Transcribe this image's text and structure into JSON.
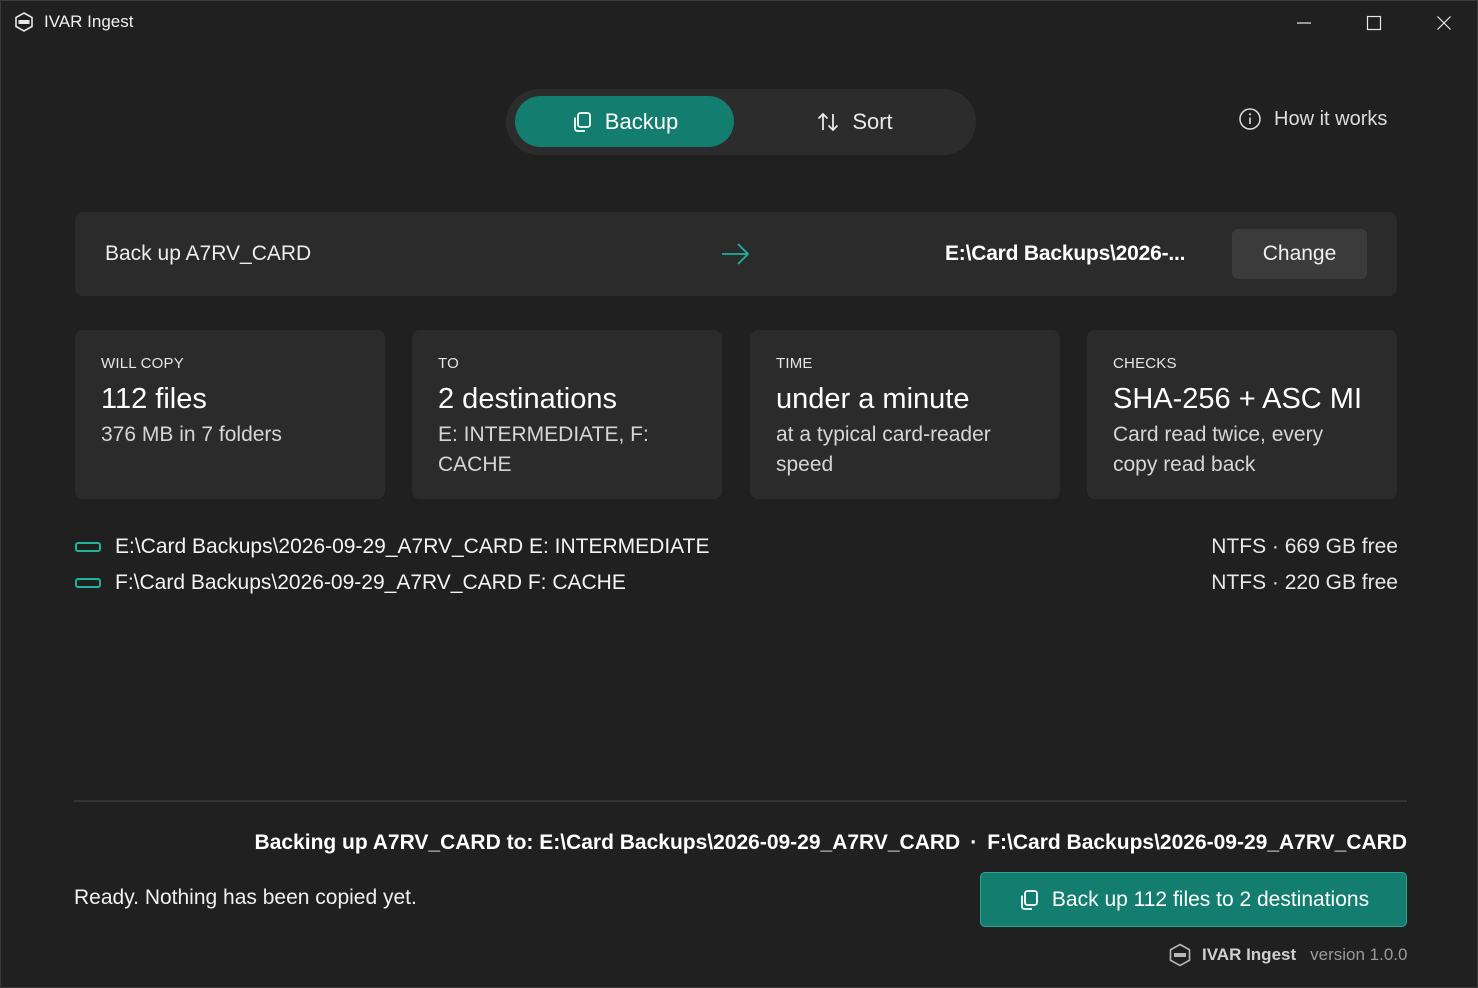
{
  "window": {
    "title": "IVAR Ingest"
  },
  "mode_toggle": {
    "backup_label": "Backup",
    "sort_label": "Sort",
    "selected": "Backup"
  },
  "help": {
    "label": "How it works"
  },
  "source_bar": {
    "label": "Back up A7RV_CARD",
    "dest_path": "E:\\Card Backups\\2026-...",
    "change_label": "Change"
  },
  "cards": [
    {
      "caption": "WILL COPY",
      "value": "112 files",
      "sub": "376 MB in 7 folders"
    },
    {
      "caption": "TO",
      "value": "2 destinations",
      "sub": "E: INTERMEDIATE, F: CACHE"
    },
    {
      "caption": "TIME",
      "value": "under a minute",
      "sub": "at a typical card-reader speed"
    },
    {
      "caption": "CHECKS",
      "value": "SHA-256 + ASC MI",
      "sub": "Card read twice, every copy read back"
    }
  ],
  "destinations": [
    {
      "path": "E:\\Card Backups\\2026-09-29_A7RV_CARD E: INTERMEDIATE",
      "free": "NTFS · 669 GB free"
    },
    {
      "path": "F:\\Card Backups\\2026-09-29_A7RV_CARD F: CACHE",
      "free": "NTFS · 220 GB free"
    }
  ],
  "summary": {
    "prefix": "Backing up A7RV_CARD to: E:\\Card Backups\\2026-09-29_A7RV_CARD",
    "separator": "·",
    "second": "F:\\Card Backups\\2026-09-29_A7RV_CARD"
  },
  "status": "Ready. Nothing has been copied yet.",
  "primary_button": {
    "label": "Back up 112 files to 2 destinations"
  },
  "footer": {
    "app_name": "IVAR Ingest",
    "version": "version 1.0.0"
  },
  "colors": {
    "accent": "#137e6f",
    "accent_icon": "#22b29c",
    "background": "#202020",
    "panel": "#2b2b2b"
  }
}
